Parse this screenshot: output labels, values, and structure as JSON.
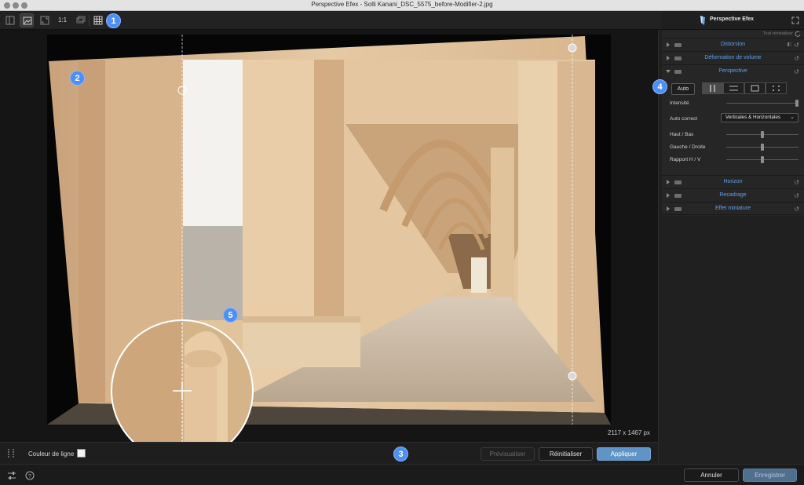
{
  "window": {
    "title": "Perspective Efex - Solli Kanani_DSC_5575_before-Modifier-2.jpg"
  },
  "toolbar": {
    "one_to_one": "1:1",
    "badge": "1"
  },
  "panel_header": {
    "title": "Perspective Efex"
  },
  "canvas": {
    "dimensions": "2117 x 1467 px",
    "badge_image": "2",
    "badge_loupe": "5"
  },
  "options_bar": {
    "line_color_label": "Couleur de ligne",
    "line_color": "#f4f4f4",
    "badge": "3",
    "preview_label": "Prévisualiser",
    "reset_label": "Réinitialiser",
    "apply_label": "Appliquer"
  },
  "footer": {
    "cancel_label": "Annuler",
    "save_label": "Enregistrer"
  },
  "panel": {
    "reset_all": "Tout réinitialiser",
    "sections": [
      {
        "name": "Distorsion"
      },
      {
        "name": "Déformation de volume"
      },
      {
        "name": "Perspective"
      },
      {
        "name": "Horizon"
      },
      {
        "name": "Recadrage"
      },
      {
        "name": "Effet miniature"
      }
    ],
    "perspective": {
      "badge": "4",
      "auto_label": "Auto",
      "intensity_label": "Intensité",
      "intensity_value": 1.0,
      "auto_correct_label": "Auto correct",
      "auto_correct_value": "Verticales & Horizontales",
      "haut_bas_label": "Haut / Bas",
      "haut_bas_value": 0.5,
      "gauche_droite_label": "Gauche / Droite",
      "gauche_droite_value": 0.5,
      "rapport_label": "Rapport H / V",
      "rapport_value": 0.5
    }
  },
  "colors": {
    "accent": "#5fa0e8",
    "badge": "#4d8ff5",
    "primary_button": "#5f94c6"
  }
}
